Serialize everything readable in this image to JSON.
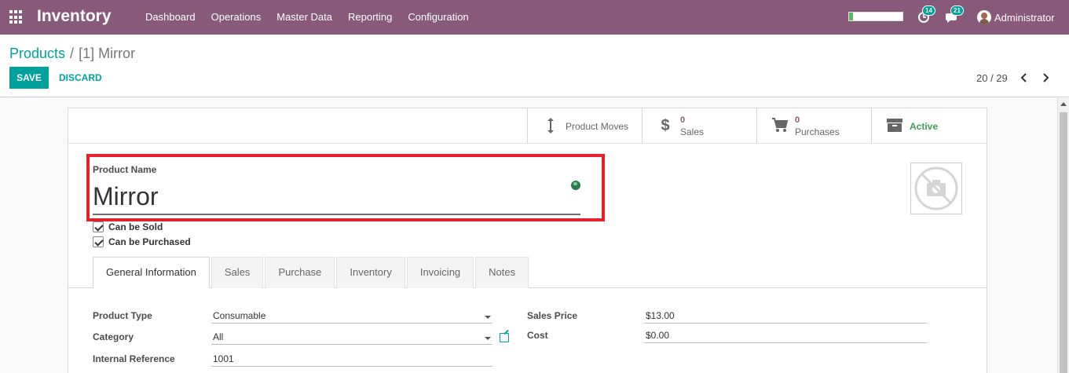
{
  "navbar": {
    "app_title": "Inventory",
    "menu": [
      "Dashboard",
      "Operations",
      "Master Data",
      "Reporting",
      "Configuration"
    ],
    "activity_badge": "14",
    "messages_badge": "21",
    "user_name": "Administrator",
    "progress_fraction": 0.08
  },
  "control_panel": {
    "breadcrumb_parent": "Products",
    "breadcrumb_separator": "/",
    "breadcrumb_current": "[1] Mirror",
    "save_label": "SAVE",
    "discard_label": "DISCARD",
    "pager": "20 / 29"
  },
  "smart_buttons": {
    "product_moves": "Product Moves",
    "sales_count": "0",
    "sales_label": "Sales",
    "purchases_count": "0",
    "purchases_label": "Purchases",
    "active_label": "Active"
  },
  "form": {
    "product_name_label": "Product Name",
    "product_name": "Mirror",
    "can_be_sold": "Can be Sold",
    "can_be_purchased": "Can be Purchased"
  },
  "tabs": [
    "General Information",
    "Sales",
    "Purchase",
    "Inventory",
    "Invoicing",
    "Notes"
  ],
  "fields": {
    "product_type_label": "Product Type",
    "product_type": "Consumable",
    "category_label": "Category",
    "category": "All",
    "internal_reference_label": "Internal Reference",
    "internal_reference": "1001",
    "sales_price_label": "Sales Price",
    "sales_price": "$13.00",
    "cost_label": "Cost",
    "cost": "$0.00"
  },
  "colors": {
    "navbar": "#875a7b",
    "accent": "#00a09d",
    "highlight": "#e4202a"
  }
}
